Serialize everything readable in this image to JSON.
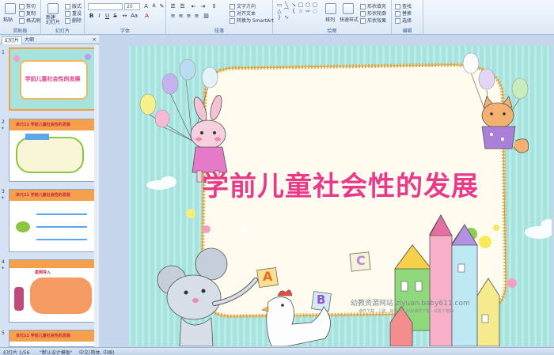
{
  "ribbon": {
    "clipboard": {
      "paste": "粘贴",
      "cut": "剪切",
      "copy": "复制",
      "format_painter": "格式刷",
      "label": "剪贴板"
    },
    "slides": {
      "new_slide": "新建\n幻灯片",
      "layout": "版式",
      "reset": "重设",
      "delete": "删除",
      "label": "幻灯片"
    },
    "font": {
      "size_value": "20",
      "label": "字体"
    },
    "paragraph": {
      "text_direction": "文字方向",
      "align_text": "对齐文本",
      "smartart": "转换为 SmartArt",
      "label": "段落"
    },
    "drawing": {
      "arrange": "排列",
      "quick_styles": "快速样式",
      "shape_fill": "形状填充",
      "shape_outline": "形状轮廓",
      "shape_effects": "形状效果",
      "label": "绘图"
    },
    "editing": {
      "find": "查找",
      "replace": "替换",
      "select": "选择",
      "label": "编辑"
    }
  },
  "left_pane": {
    "tab_slides": "幻灯片",
    "tab_outline": "大纲",
    "close": "×",
    "thumbnails": [
      {
        "num": "1",
        "title": "学前儿童社会性的发展",
        "selected": true
      },
      {
        "num": "2",
        "title": "单元11  学前儿童社会性的发展",
        "selected": false
      },
      {
        "num": "3",
        "title": "单元11  学前儿童社会性的发展",
        "selected": false
      },
      {
        "num": "4",
        "title": "案例导入",
        "selected": false
      },
      {
        "num": "5",
        "title": "单元11  学前儿童社会性的发展",
        "selected": false
      }
    ]
  },
  "slide": {
    "title": "学前儿童社会性的发展",
    "watermark_main": "幼教资源网站  ziyuan.baby611.com",
    "watermark_sub": "课件下载 · 儿歌 · 故事 · FLASH课件下载 · 试卷下载等"
  },
  "letters": {
    "a": "A",
    "b": "B",
    "c": "C"
  },
  "status": {
    "slide_info": "幻灯片 1/56",
    "theme": "\"默认设计模板\"",
    "language": "中文(简体, 中国)"
  }
}
